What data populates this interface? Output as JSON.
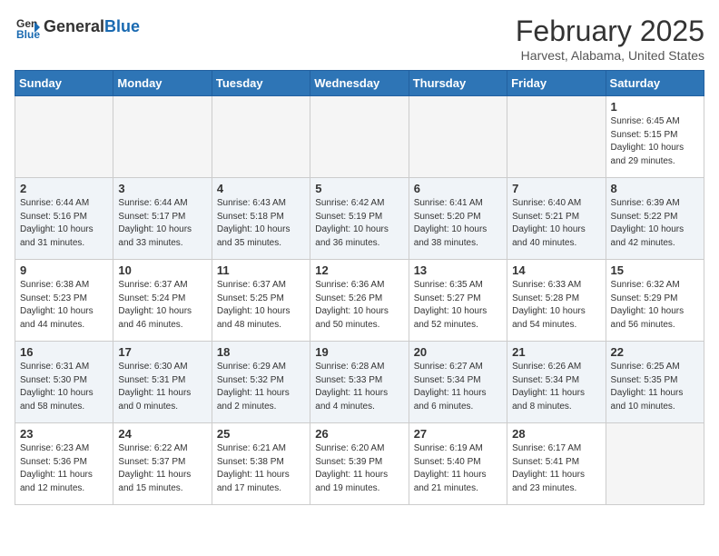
{
  "header": {
    "logo_general": "General",
    "logo_blue": "Blue",
    "month_year": "February 2025",
    "location": "Harvest, Alabama, United States"
  },
  "weekdays": [
    "Sunday",
    "Monday",
    "Tuesday",
    "Wednesday",
    "Thursday",
    "Friday",
    "Saturday"
  ],
  "weeks": [
    [
      {
        "day": "",
        "info": ""
      },
      {
        "day": "",
        "info": ""
      },
      {
        "day": "",
        "info": ""
      },
      {
        "day": "",
        "info": ""
      },
      {
        "day": "",
        "info": ""
      },
      {
        "day": "",
        "info": ""
      },
      {
        "day": "1",
        "info": "Sunrise: 6:45 AM\nSunset: 5:15 PM\nDaylight: 10 hours and 29 minutes."
      }
    ],
    [
      {
        "day": "2",
        "info": "Sunrise: 6:44 AM\nSunset: 5:16 PM\nDaylight: 10 hours and 31 minutes."
      },
      {
        "day": "3",
        "info": "Sunrise: 6:44 AM\nSunset: 5:17 PM\nDaylight: 10 hours and 33 minutes."
      },
      {
        "day": "4",
        "info": "Sunrise: 6:43 AM\nSunset: 5:18 PM\nDaylight: 10 hours and 35 minutes."
      },
      {
        "day": "5",
        "info": "Sunrise: 6:42 AM\nSunset: 5:19 PM\nDaylight: 10 hours and 36 minutes."
      },
      {
        "day": "6",
        "info": "Sunrise: 6:41 AM\nSunset: 5:20 PM\nDaylight: 10 hours and 38 minutes."
      },
      {
        "day": "7",
        "info": "Sunrise: 6:40 AM\nSunset: 5:21 PM\nDaylight: 10 hours and 40 minutes."
      },
      {
        "day": "8",
        "info": "Sunrise: 6:39 AM\nSunset: 5:22 PM\nDaylight: 10 hours and 42 minutes."
      }
    ],
    [
      {
        "day": "9",
        "info": "Sunrise: 6:38 AM\nSunset: 5:23 PM\nDaylight: 10 hours and 44 minutes."
      },
      {
        "day": "10",
        "info": "Sunrise: 6:37 AM\nSunset: 5:24 PM\nDaylight: 10 hours and 46 minutes."
      },
      {
        "day": "11",
        "info": "Sunrise: 6:37 AM\nSunset: 5:25 PM\nDaylight: 10 hours and 48 minutes."
      },
      {
        "day": "12",
        "info": "Sunrise: 6:36 AM\nSunset: 5:26 PM\nDaylight: 10 hours and 50 minutes."
      },
      {
        "day": "13",
        "info": "Sunrise: 6:35 AM\nSunset: 5:27 PM\nDaylight: 10 hours and 52 minutes."
      },
      {
        "day": "14",
        "info": "Sunrise: 6:33 AM\nSunset: 5:28 PM\nDaylight: 10 hours and 54 minutes."
      },
      {
        "day": "15",
        "info": "Sunrise: 6:32 AM\nSunset: 5:29 PM\nDaylight: 10 hours and 56 minutes."
      }
    ],
    [
      {
        "day": "16",
        "info": "Sunrise: 6:31 AM\nSunset: 5:30 PM\nDaylight: 10 hours and 58 minutes."
      },
      {
        "day": "17",
        "info": "Sunrise: 6:30 AM\nSunset: 5:31 PM\nDaylight: 11 hours and 0 minutes."
      },
      {
        "day": "18",
        "info": "Sunrise: 6:29 AM\nSunset: 5:32 PM\nDaylight: 11 hours and 2 minutes."
      },
      {
        "day": "19",
        "info": "Sunrise: 6:28 AM\nSunset: 5:33 PM\nDaylight: 11 hours and 4 minutes."
      },
      {
        "day": "20",
        "info": "Sunrise: 6:27 AM\nSunset: 5:34 PM\nDaylight: 11 hours and 6 minutes."
      },
      {
        "day": "21",
        "info": "Sunrise: 6:26 AM\nSunset: 5:34 PM\nDaylight: 11 hours and 8 minutes."
      },
      {
        "day": "22",
        "info": "Sunrise: 6:25 AM\nSunset: 5:35 PM\nDaylight: 11 hours and 10 minutes."
      }
    ],
    [
      {
        "day": "23",
        "info": "Sunrise: 6:23 AM\nSunset: 5:36 PM\nDaylight: 11 hours and 12 minutes."
      },
      {
        "day": "24",
        "info": "Sunrise: 6:22 AM\nSunset: 5:37 PM\nDaylight: 11 hours and 15 minutes."
      },
      {
        "day": "25",
        "info": "Sunrise: 6:21 AM\nSunset: 5:38 PM\nDaylight: 11 hours and 17 minutes."
      },
      {
        "day": "26",
        "info": "Sunrise: 6:20 AM\nSunset: 5:39 PM\nDaylight: 11 hours and 19 minutes."
      },
      {
        "day": "27",
        "info": "Sunrise: 6:19 AM\nSunset: 5:40 PM\nDaylight: 11 hours and 21 minutes."
      },
      {
        "day": "28",
        "info": "Sunrise: 6:17 AM\nSunset: 5:41 PM\nDaylight: 11 hours and 23 minutes."
      },
      {
        "day": "",
        "info": ""
      }
    ]
  ]
}
